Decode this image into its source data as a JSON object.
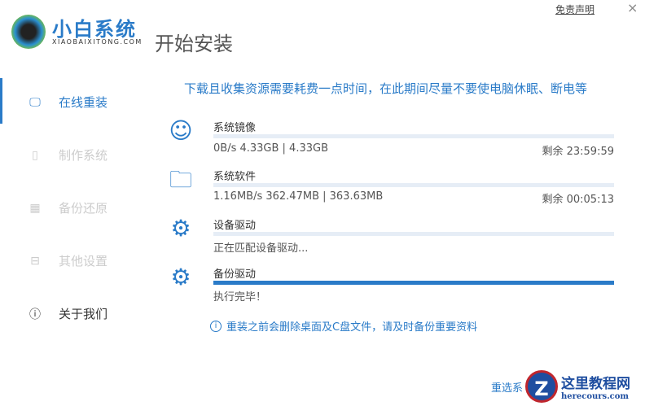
{
  "app": {
    "brand": "小白系统",
    "brand_sub": "XIAOBAIXITONG.COM",
    "title": "开始安装",
    "disclaimer": "免责声明",
    "close": "×"
  },
  "sidebar": {
    "items": [
      {
        "label": "在线重装",
        "icon": "monitor-icon",
        "glyph": "🖵"
      },
      {
        "label": "制作系统",
        "icon": "usb-icon",
        "glyph": "▯"
      },
      {
        "label": "备份还原",
        "icon": "backup-icon",
        "glyph": "▦"
      },
      {
        "label": "其他设置",
        "icon": "briefcase-icon",
        "glyph": "⊟"
      },
      {
        "label": "关于我们",
        "icon": "info-icon",
        "glyph": "ⓘ"
      }
    ]
  },
  "notice": "下载且收集资源需要耗费一点时间，在此期间尽量不要使电脑休眠、断电等",
  "tasks": [
    {
      "label": "系统镜像",
      "icon": "chat-bubble-icon",
      "glyph": "☺",
      "progress": 0,
      "stat": "0B/s 4.33GB | 4.33GB",
      "remain": "剩余 23:59:59"
    },
    {
      "label": "系统软件",
      "icon": "folder-apps-icon",
      "glyph": "🗀",
      "progress": 0,
      "stat": "1.16MB/s 362.47MB | 363.63MB",
      "remain": "剩余 00:05:13"
    },
    {
      "label": "设备驱动",
      "icon": "gear-icon",
      "glyph": "⚙",
      "progress": 0,
      "stat": "正在匹配设备驱动..."
    },
    {
      "label": "备份驱动",
      "icon": "gear-sync-icon",
      "glyph": "⚙",
      "progress": 100,
      "stat": "执行完毕！"
    }
  ],
  "warning": "重装之前会删除桌面及C盘文件，请及时备份重要资料",
  "reselect": "重选系",
  "watermark": {
    "title": "这里教程网",
    "url": "herecours.com",
    "letter": "Z"
  }
}
